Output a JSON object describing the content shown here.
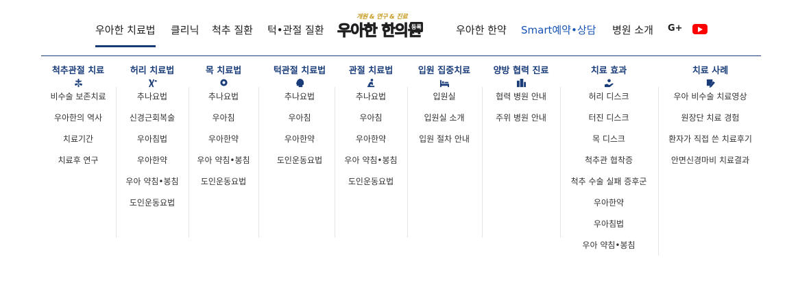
{
  "topnav": {
    "items": [
      "우아한 치료법",
      "클리닉",
      "척추 질환",
      "턱•관절 질환"
    ],
    "logo_tag": "개원 & 연구 & 진료",
    "logo_name": "우아한 한의원",
    "logo_badge": "등록",
    "items_after": [
      "우아한 한약"
    ],
    "smart": "Smart예약•상담",
    "intro": "병원 소개",
    "gplus": "G+",
    "youtube_icon": "youtube-icon",
    "accent_color": "#163c77"
  },
  "menu": {
    "columns": [
      {
        "title": "척추관절 치료",
        "icon": "spine-icon",
        "items": [
          "비수술 보존치료",
          "우아한의 역사",
          "치료기간",
          "치료후 연구"
        ]
      },
      {
        "title": "허리 치료법",
        "icon": "back-pain-icon",
        "items": [
          "추나요법",
          "신경근회복술",
          "우아침법",
          "우아한약",
          "우아 약침•봉침",
          "도인운동요법"
        ]
      },
      {
        "title": "목 치료법",
        "icon": "neck-icon",
        "items": [
          "추나요법",
          "우아침",
          "우아한약",
          "우아 약침•봉침",
          "도인운동요법"
        ]
      },
      {
        "title": "턱관절 치료법",
        "icon": "jaw-icon",
        "items": [
          "추나요법",
          "우아침",
          "우아한약",
          "도인운동요법"
        ]
      },
      {
        "title": "관절 치료법",
        "icon": "joint-icon",
        "items": [
          "추나요법",
          "우아침",
          "우아한약",
          "우아 약침•봉침",
          "도인운동요법"
        ]
      },
      {
        "title": "입원 집중치료",
        "icon": "bed-icon",
        "items": [
          "입원실",
          "입원실 소개",
          "입원 절차 안내"
        ]
      },
      {
        "title": "양방 협력 진료",
        "icon": "hospital-icon",
        "items": [
          "협력 병원 안내",
          "주위 병원 안내"
        ]
      },
      {
        "title": "치료 효과",
        "icon": "hand-care-icon",
        "items": [
          "허리 디스크",
          "터진 디스크",
          "목 디스크",
          "척추관 협착증",
          "척추 수술 실패 증후군",
          "우아한약",
          "우아침법",
          "우아 약침•봉침"
        ]
      },
      {
        "title": "치료 사례",
        "icon": "case-note-icon",
        "items": [
          "우아 비수술 치료영상",
          "원장단 치료 경험",
          "환자가 직접 쓴 치료후기",
          "안면신경마비 치료결과"
        ]
      }
    ]
  }
}
